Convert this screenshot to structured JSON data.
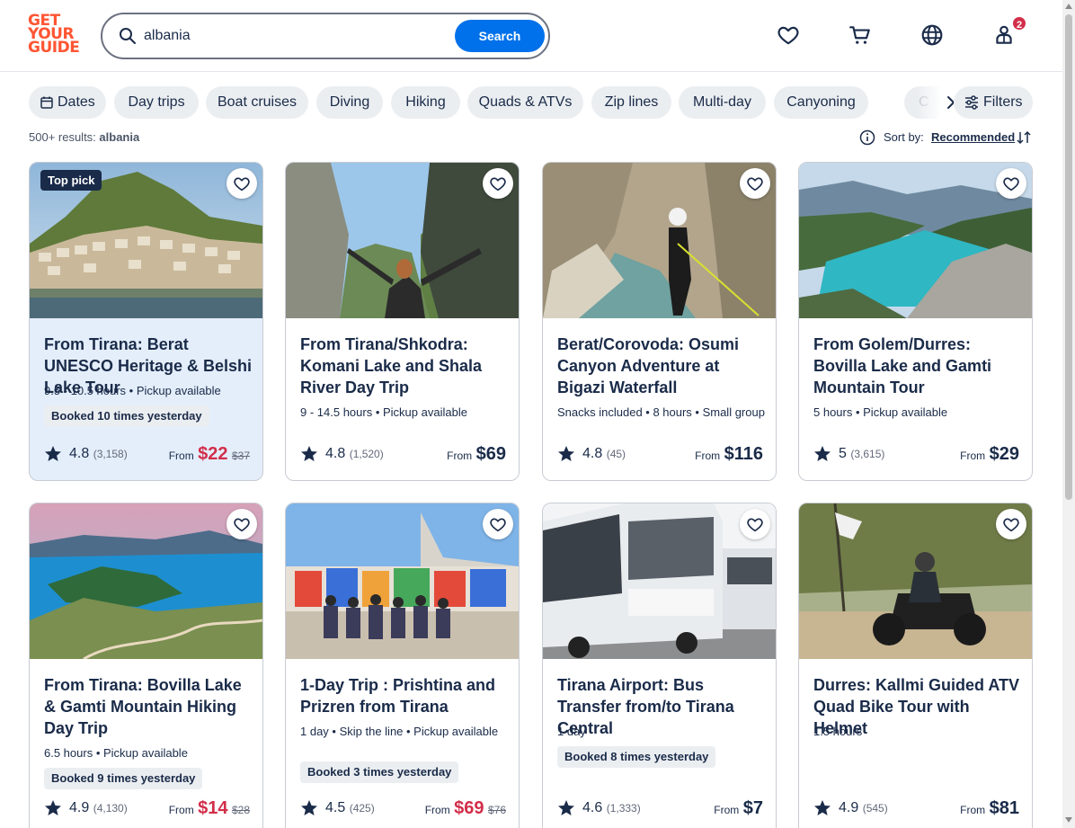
{
  "header": {
    "logo_lines": [
      "GET",
      "YOUR",
      "GUIDE"
    ],
    "search_value": "albania",
    "search_button": "Search",
    "cart_badge": "2",
    "icons": [
      "heart-icon",
      "cart-icon",
      "globe-icon",
      "profile-icon"
    ]
  },
  "filters": {
    "chips": [
      "Dates",
      "Day trips",
      "Boat cruises",
      "Diving",
      "Hiking",
      "Quads & ATVs",
      "Zip lines",
      "Multi-day",
      "Canyoning"
    ],
    "truncated_chip": "C",
    "filters_label": "Filters"
  },
  "results": {
    "count": "500+ results:",
    "query": "albania",
    "sort_label": "Sort by:",
    "sort_value": "Recommended"
  },
  "colors": {
    "accent": "#0071eb",
    "brand": "#ff5533",
    "sale": "#d22e4a",
    "text": "#1a2b49"
  },
  "cards": [
    {
      "tag": "Top pick",
      "title": "From Tirana: Berat UNESCO Heritage & Belshi Lake Tour",
      "meta": "9.5 - 10.5 hours • Pickup available",
      "booked": "Booked 10 times yesterday",
      "rating": "4.8",
      "reviews": "(3,158)",
      "from": "From",
      "price": "$22",
      "old_price": "$37"
    },
    {
      "title": "From Tirana/Shkodra: Komani Lake and Shala River Day Trip",
      "meta": "9 - 14.5 hours • Pickup available",
      "rating": "4.8",
      "reviews": "(1,520)",
      "from": "From",
      "price": "$69"
    },
    {
      "title": "Berat/Corovoda: Osumi Canyon Adventure at Bigazi Waterfall",
      "meta": "Snacks included • 8 hours • Small group",
      "rating": "4.8",
      "reviews": "(45)",
      "from": "From",
      "price": "$116"
    },
    {
      "title": "From Golem/Durres: Bovilla Lake and Gamti Mountain Tour",
      "meta": "5 hours • Pickup available",
      "rating": "5",
      "reviews": "(3,615)",
      "from": "From",
      "price": "$29"
    },
    {
      "title": "From Tirana: Bovilla Lake & Gamti Mountain Hiking Day Trip",
      "meta": "6.5 hours • Pickup available",
      "booked": "Booked 9 times yesterday",
      "rating": "4.9",
      "reviews": "(4,130)",
      "from": "From",
      "price": "$14",
      "old_price": "$28"
    },
    {
      "title": "1-Day Trip : Prishtina and Prizren from Tirana",
      "meta": "1 day • Skip the line • Pickup available",
      "booked": "Booked 3 times yesterday",
      "rating": "4.5",
      "reviews": "(425)",
      "from": "From",
      "price": "$69",
      "old_price": "$76"
    },
    {
      "title": "Tirana Airport: Bus Transfer from/to Tirana Central",
      "meta": "1 day",
      "booked": "Booked 8 times yesterday",
      "rating": "4.6",
      "reviews": "(1,333)",
      "from": "From",
      "price": "$7"
    },
    {
      "title": "Durres: Kallmi Guided ATV Quad Bike Tour with Helmet",
      "meta": "1.5 hours",
      "rating": "4.9",
      "reviews": "(545)",
      "from": "From",
      "price": "$81"
    }
  ]
}
